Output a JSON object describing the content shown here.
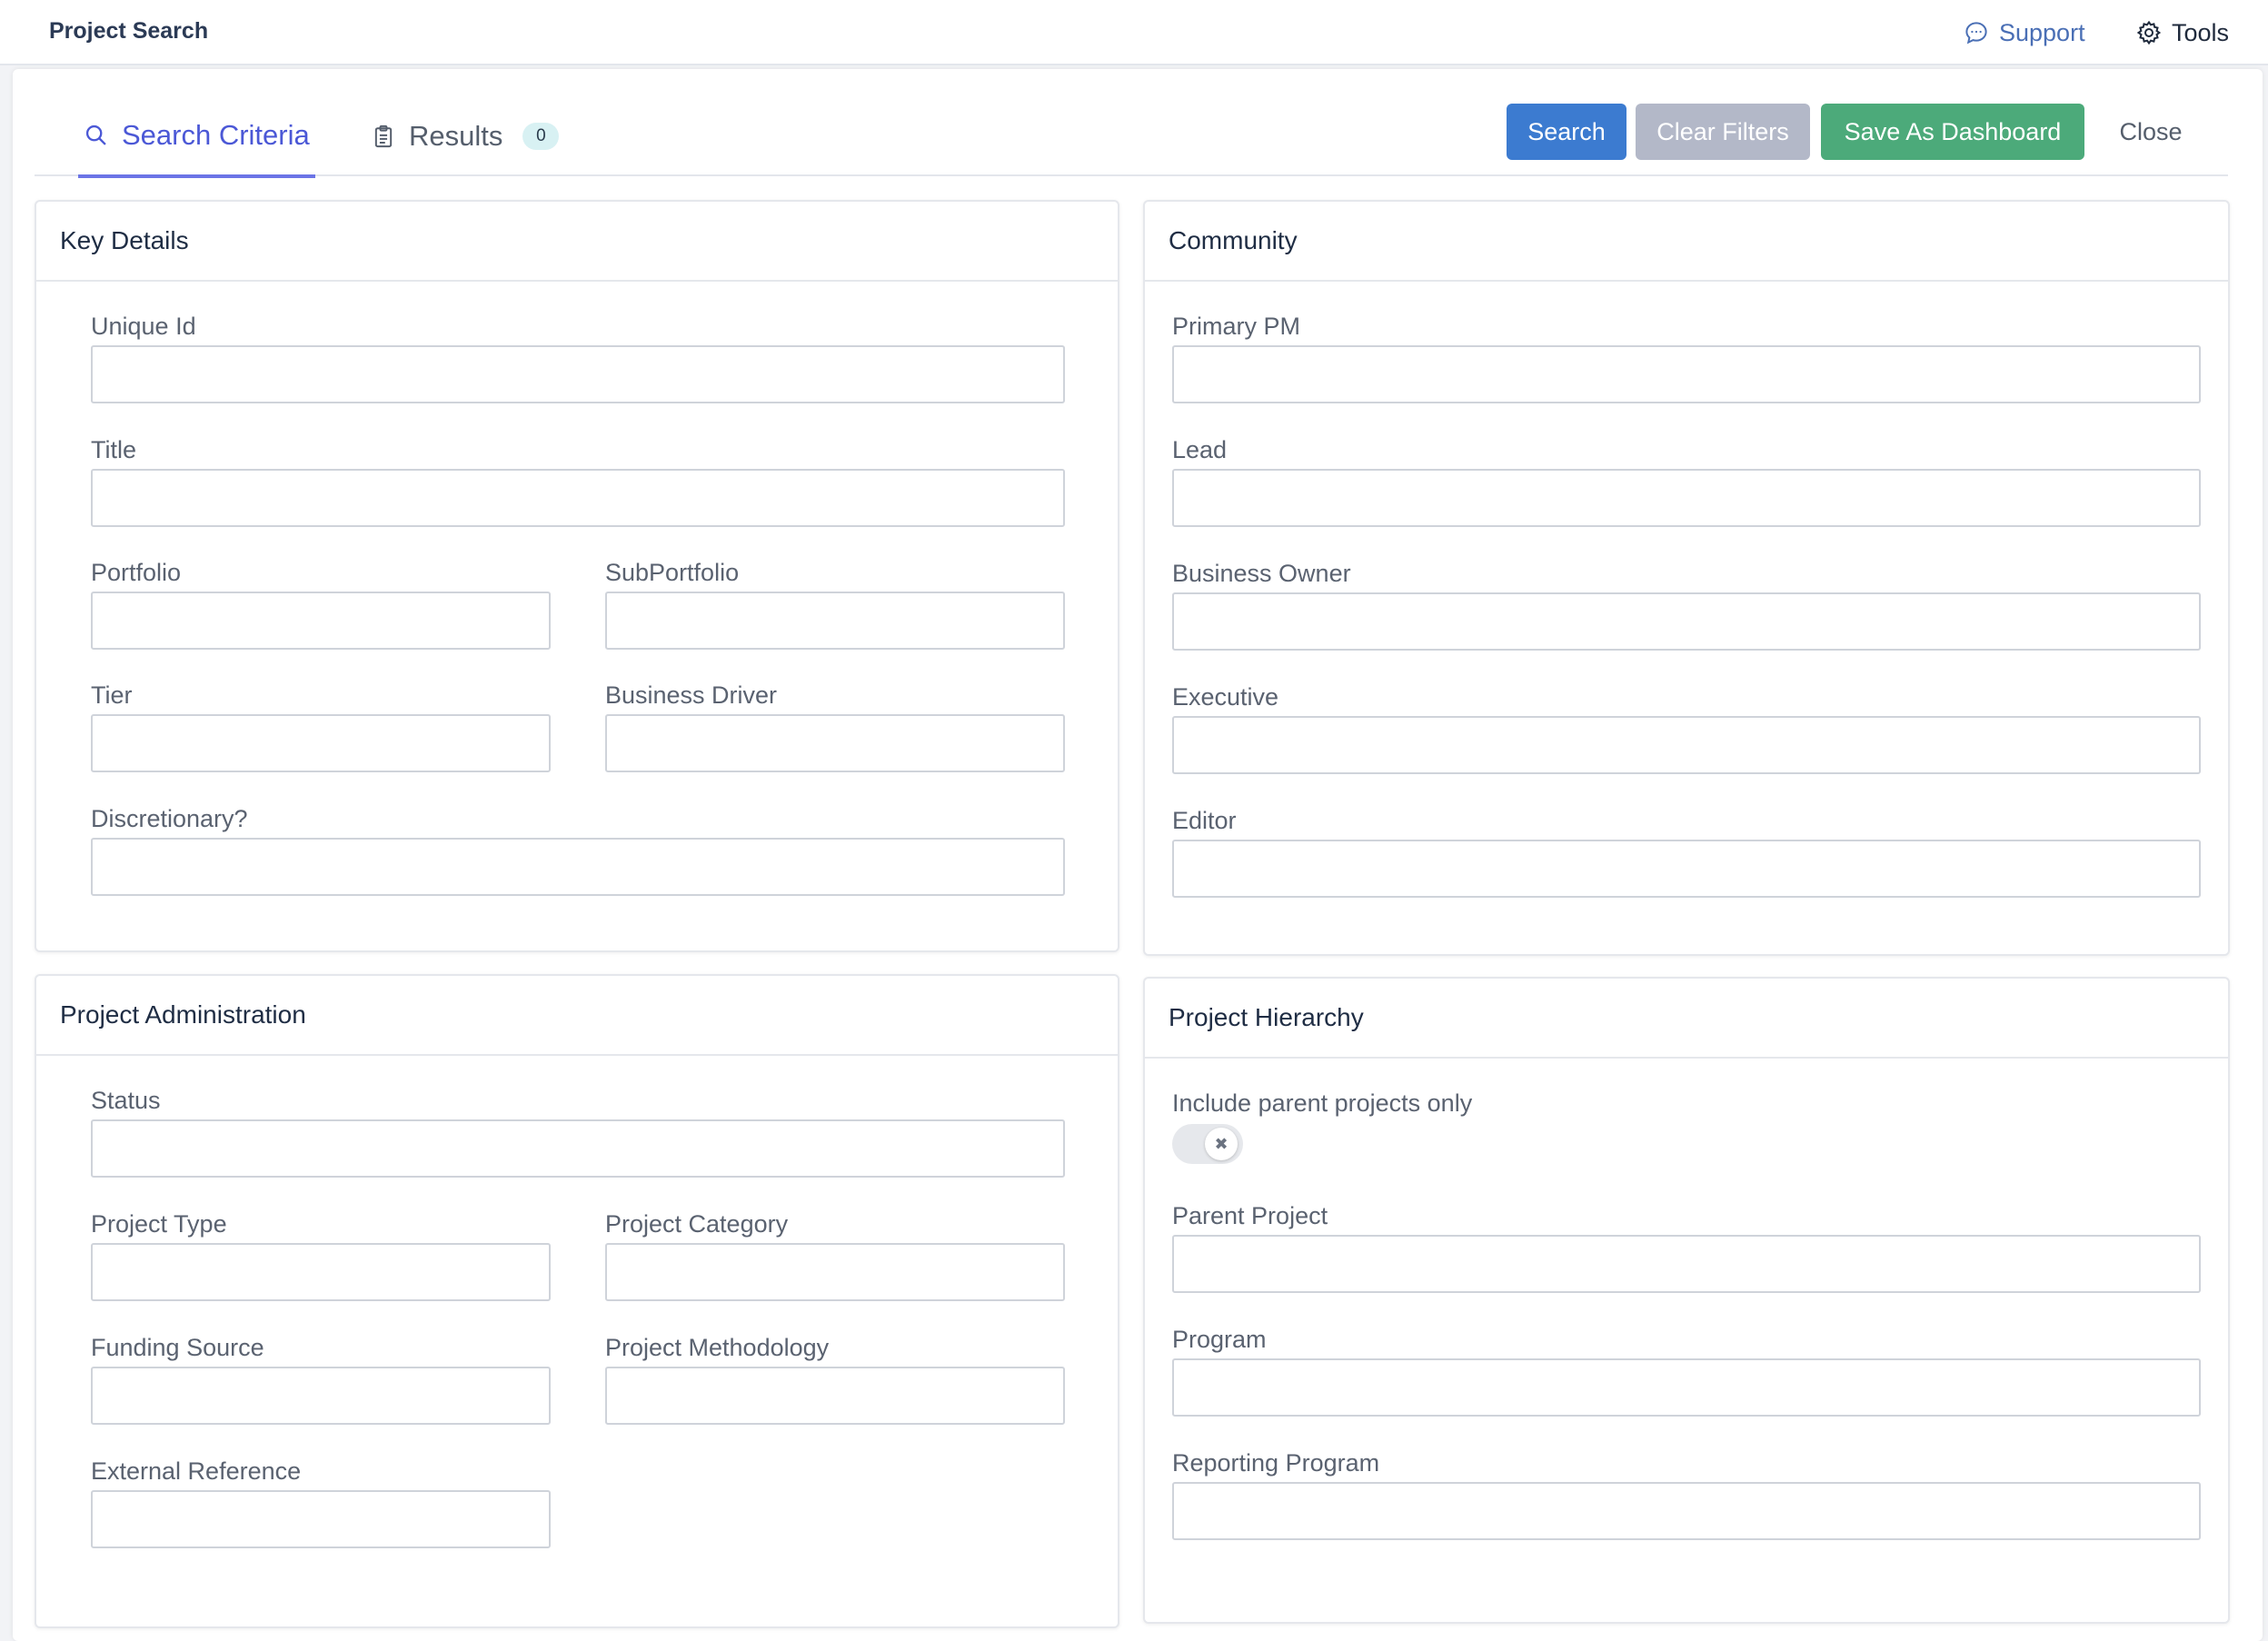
{
  "app": {
    "title": "Project Search"
  },
  "topbar": {
    "support_label": "Support",
    "tools_label": "Tools"
  },
  "tabs": [
    {
      "label": "Search Criteria",
      "active": true
    },
    {
      "label": "Results",
      "count": "0"
    }
  ],
  "toolbar": {
    "search_label": "Search",
    "clear_label": "Clear Filters",
    "save_label": "Save As Dashboard",
    "close_label": "Close"
  },
  "colors": {
    "accent": "#4b58d6",
    "primary_button": "#3c7bd0",
    "disabled_button": "#b3b8c8",
    "success_button": "#4caa7a"
  },
  "key_details": {
    "title": "Key Details",
    "fields": {
      "unique_id": {
        "label": "Unique Id",
        "value": ""
      },
      "title": {
        "label": "Title",
        "value": ""
      },
      "portfolio": {
        "label": "Portfolio",
        "value": ""
      },
      "subportfolio": {
        "label": "SubPortfolio",
        "value": ""
      },
      "tier": {
        "label": "Tier",
        "value": ""
      },
      "business_driver": {
        "label": "Business Driver",
        "value": ""
      },
      "discretionary": {
        "label": "Discretionary?",
        "value": ""
      }
    }
  },
  "community": {
    "title": "Community",
    "fields": {
      "primary_pm": {
        "label": "Primary PM",
        "value": ""
      },
      "lead": {
        "label": "Lead",
        "value": ""
      },
      "business_owner": {
        "label": "Business Owner",
        "value": ""
      },
      "executive": {
        "label": "Executive",
        "value": ""
      },
      "editor": {
        "label": "Editor",
        "value": ""
      }
    }
  },
  "project_administration": {
    "title": "Project Administration",
    "fields": {
      "status": {
        "label": "Status",
        "value": ""
      },
      "project_type": {
        "label": "Project Type",
        "value": ""
      },
      "project_category": {
        "label": "Project Category",
        "value": ""
      },
      "funding_source": {
        "label": "Funding Source",
        "value": ""
      },
      "project_methodology": {
        "label": "Project Methodology",
        "value": ""
      },
      "external_reference": {
        "label": "External Reference",
        "value": ""
      }
    }
  },
  "project_hierarchy": {
    "title": "Project Hierarchy",
    "parent_only": {
      "label": "Include parent projects only",
      "enabled": false
    },
    "fields": {
      "parent_project": {
        "label": "Parent Project",
        "value": ""
      },
      "program": {
        "label": "Program",
        "value": ""
      },
      "reporting_program": {
        "label": "Reporting Program",
        "value": ""
      }
    }
  }
}
